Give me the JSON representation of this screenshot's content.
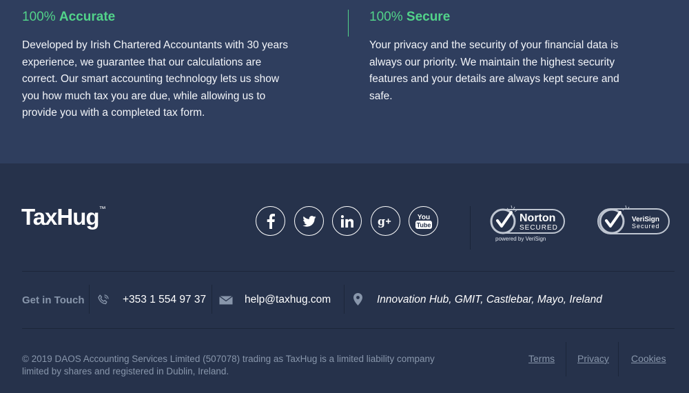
{
  "features": [
    {
      "prefix": "100%",
      "title": "Accurate",
      "text": "Developed by Irish Chartered Accountants with 30 years experience, we guarantee that our calculations are correct. Our smart accounting technology lets us show you how much tax you are due, while allowing us to provide you with a completed tax form."
    },
    {
      "prefix": "100%",
      "title": "Secure",
      "text": "Your privacy and the security of your financial data is always our priority. We maintain the highest security features and your details are always kept secure and safe."
    }
  ],
  "footer": {
    "logo": "TaxHug",
    "logo_tm": "™",
    "social": [
      "facebook-icon",
      "twitter-icon",
      "linkedin-icon",
      "google-plus-icon",
      "youtube-icon"
    ],
    "badges": {
      "norton": {
        "name": "Norton",
        "secured": "SECURED",
        "powered": "powered by VeriSign"
      },
      "verisign": {
        "line1": "VeriSign",
        "line2": "Secured"
      }
    },
    "contact": {
      "label": "Get in Touch",
      "phone": "+353 1 554 97 37",
      "email": "help@taxhug.com",
      "address": "Innovation Hub, GMIT, Castlebar, Mayo, Ireland"
    },
    "copyright": "© 2019 DAOS Accounting Services Limited (507078) trading as TaxHug is a limited liability company limited by shares and registered in Dublin, Ireland.",
    "links": {
      "terms": "Terms",
      "privacy": "Privacy",
      "cookies": "Cookies"
    }
  },
  "colors": {
    "accent_green": "#52d38a",
    "top_bg": "#2f3e5e",
    "footer_bg": "#26324b",
    "muted_text": "#8896ab"
  }
}
